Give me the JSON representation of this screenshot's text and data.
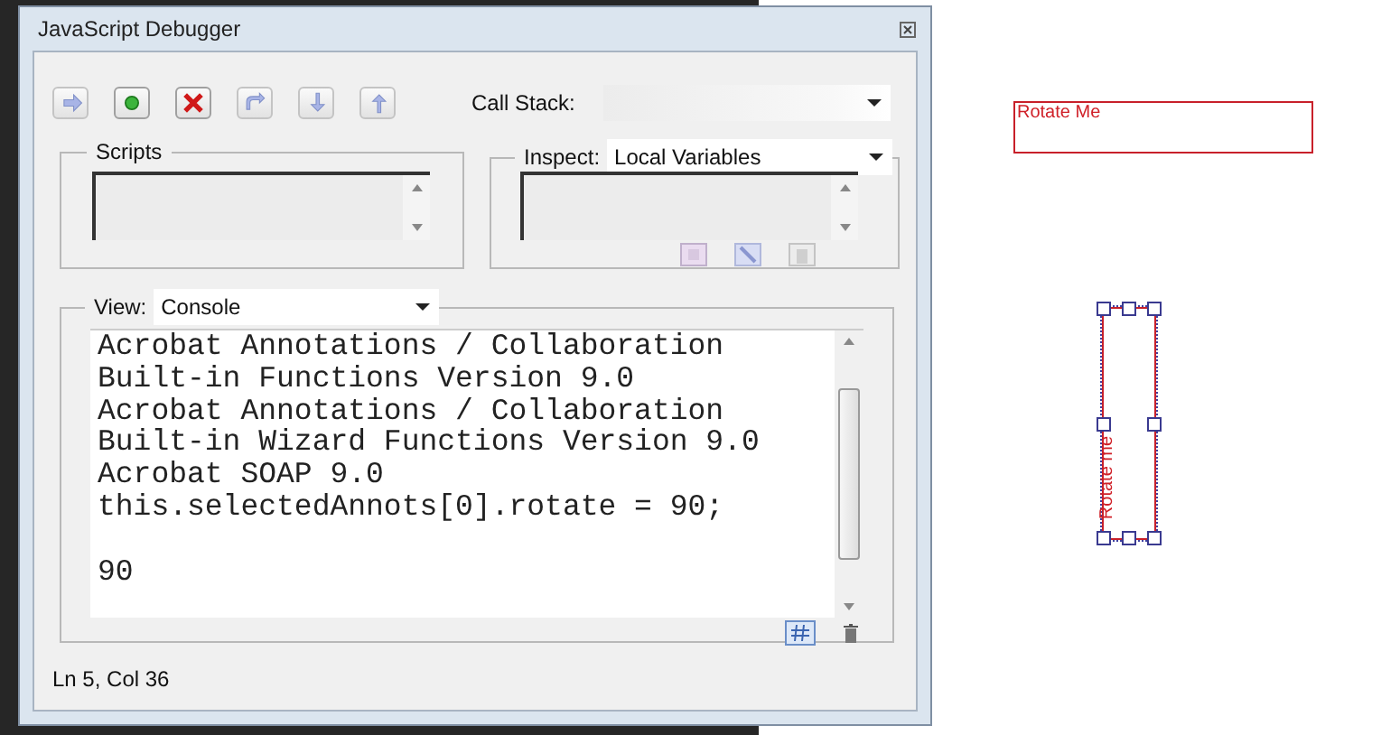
{
  "window": {
    "title": "JavaScript Debugger"
  },
  "toolbar": [
    {
      "kind": "continue",
      "disabled": true
    },
    {
      "kind": "break",
      "disabled": false
    },
    {
      "kind": "quit",
      "disabled": false
    },
    {
      "kind": "step-over",
      "disabled": true
    },
    {
      "kind": "step-into",
      "disabled": true
    },
    {
      "kind": "step-out",
      "disabled": true
    }
  ],
  "call_stack": {
    "label": "Call Stack:"
  },
  "scripts": {
    "label": "Scripts"
  },
  "inspect": {
    "label": "Inspect:",
    "value": "Local Variables"
  },
  "view": {
    "label": "View:",
    "value": "Console"
  },
  "console": {
    "text": "Acrobat Annotations / Collaboration\nBuilt-in Functions Version 9.0\nAcrobat Annotations / Collaboration\nBuilt-in Wizard Functions Version 9.0\nAcrobat SOAP 9.0\nthis.selectedAnnots[0].rotate = 90;\n\n90"
  },
  "status_bar": "Ln 5, Col 36",
  "annotations": [
    {
      "kind": "horizontal",
      "text": "Rotate Me",
      "selected": false
    },
    {
      "kind": "vertical",
      "text": "Rotate me",
      "selected": true
    }
  ]
}
